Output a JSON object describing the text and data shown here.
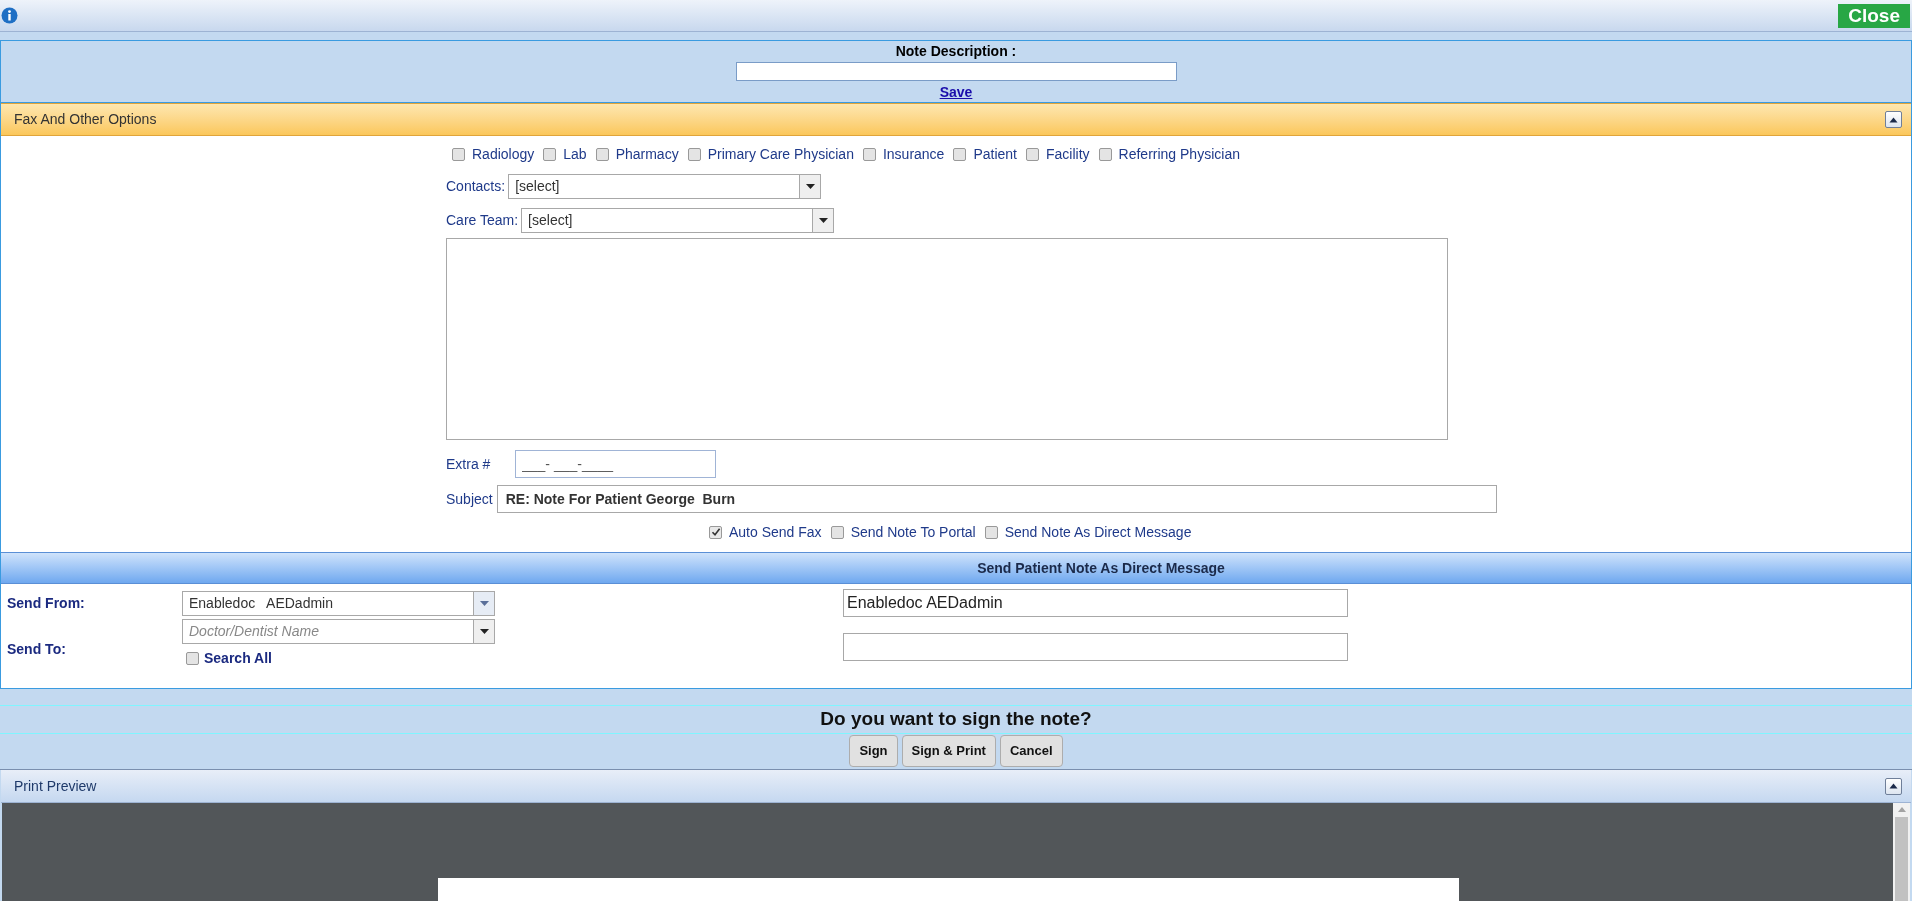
{
  "top_bar": {
    "close_label": "Close"
  },
  "note_description": {
    "label": "Note Description :",
    "save_link": "Save"
  },
  "fax_options": {
    "title": "Fax And Other Options",
    "expanded": true,
    "recipients": [
      {
        "label": "Radiology",
        "checked": false
      },
      {
        "label": "Lab",
        "checked": false
      },
      {
        "label": "Pharmacy",
        "checked": false
      },
      {
        "label": "Primary Care Physician",
        "checked": false
      },
      {
        "label": "Insurance",
        "checked": false
      },
      {
        "label": "Patient",
        "checked": false
      },
      {
        "label": "Facility",
        "checked": false
      },
      {
        "label": "Referring Physician",
        "checked": false
      }
    ],
    "contacts": {
      "label": "Contacts:",
      "value": "[select]"
    },
    "care_team": {
      "label": "Care Team:",
      "value": "[select]"
    },
    "extra": {
      "label": "Extra #",
      "value": "___- ___-____"
    },
    "subject": {
      "label": "Subject",
      "value": "RE: Note For Patient George  Burn"
    },
    "send_options": [
      {
        "label": "Auto Send Fax",
        "checked": true
      },
      {
        "label": "Send Note To Portal",
        "checked": false
      },
      {
        "label": "Send Note As Direct Message",
        "checked": false
      }
    ]
  },
  "direct_message": {
    "title": "Send Patient Note As Direct Message",
    "send_from": {
      "label": "Send From:",
      "value": "Enabledoc   AEDadmin",
      "address": "Enabledoc AEDadmin"
    },
    "send_to": {
      "label": "Send To:",
      "placeholder": "Doctor/Dentist Name",
      "search_all": {
        "label": "Search All",
        "checked": false
      }
    }
  },
  "sign": {
    "question": "Do you want to sign the note?",
    "buttons": [
      "Sign",
      "Sign & Print",
      "Cancel"
    ]
  },
  "print_preview": {
    "title": "Print Preview",
    "expanded": true
  }
}
